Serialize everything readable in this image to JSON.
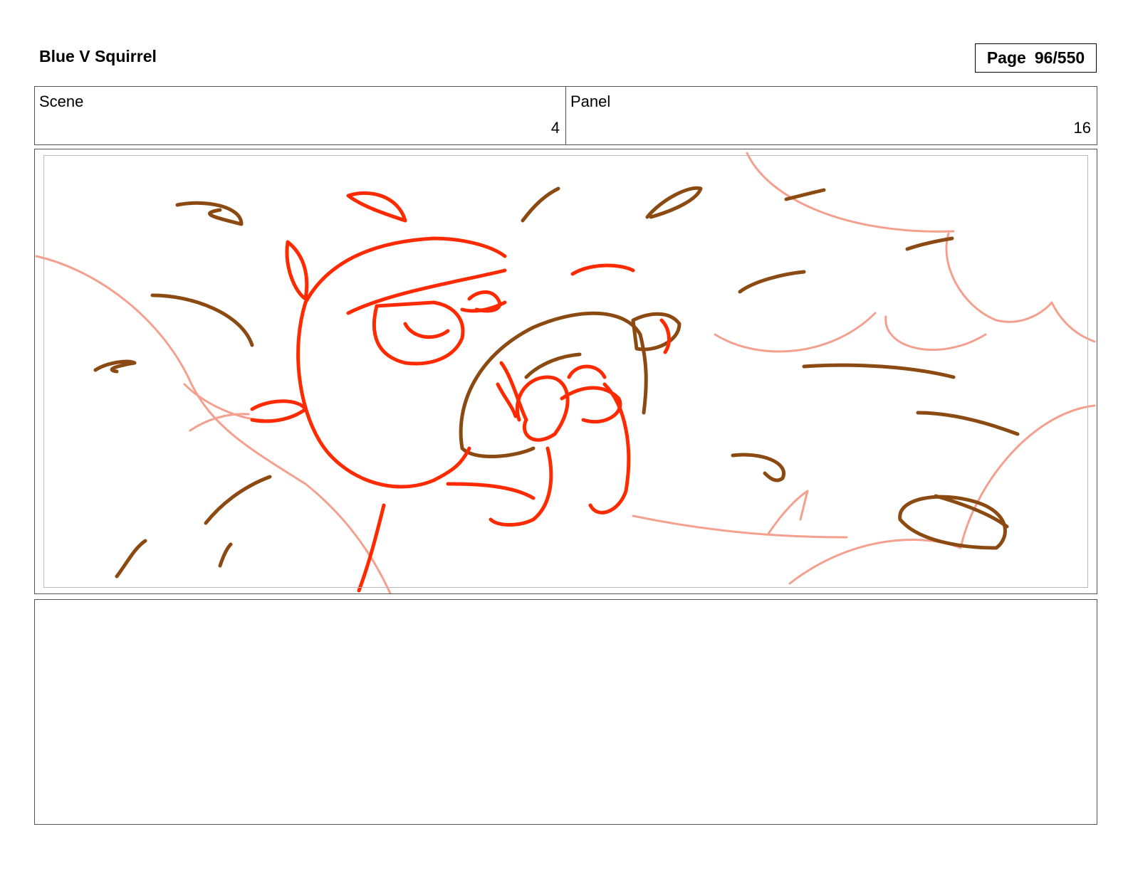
{
  "header": {
    "title": "Blue V Squirrel",
    "page_label": "Page",
    "page_number": "96/550"
  },
  "info": {
    "scene_label": "Scene",
    "scene_value": "4",
    "panel_label": "Panel",
    "panel_value": "16"
  },
  "sketch": {
    "colors": {
      "red": "#ff2a00",
      "brown": "#8b4a12",
      "pink": "#f4a08e"
    },
    "icon": "storyboard-sketch"
  },
  "notes": {
    "text": ""
  }
}
